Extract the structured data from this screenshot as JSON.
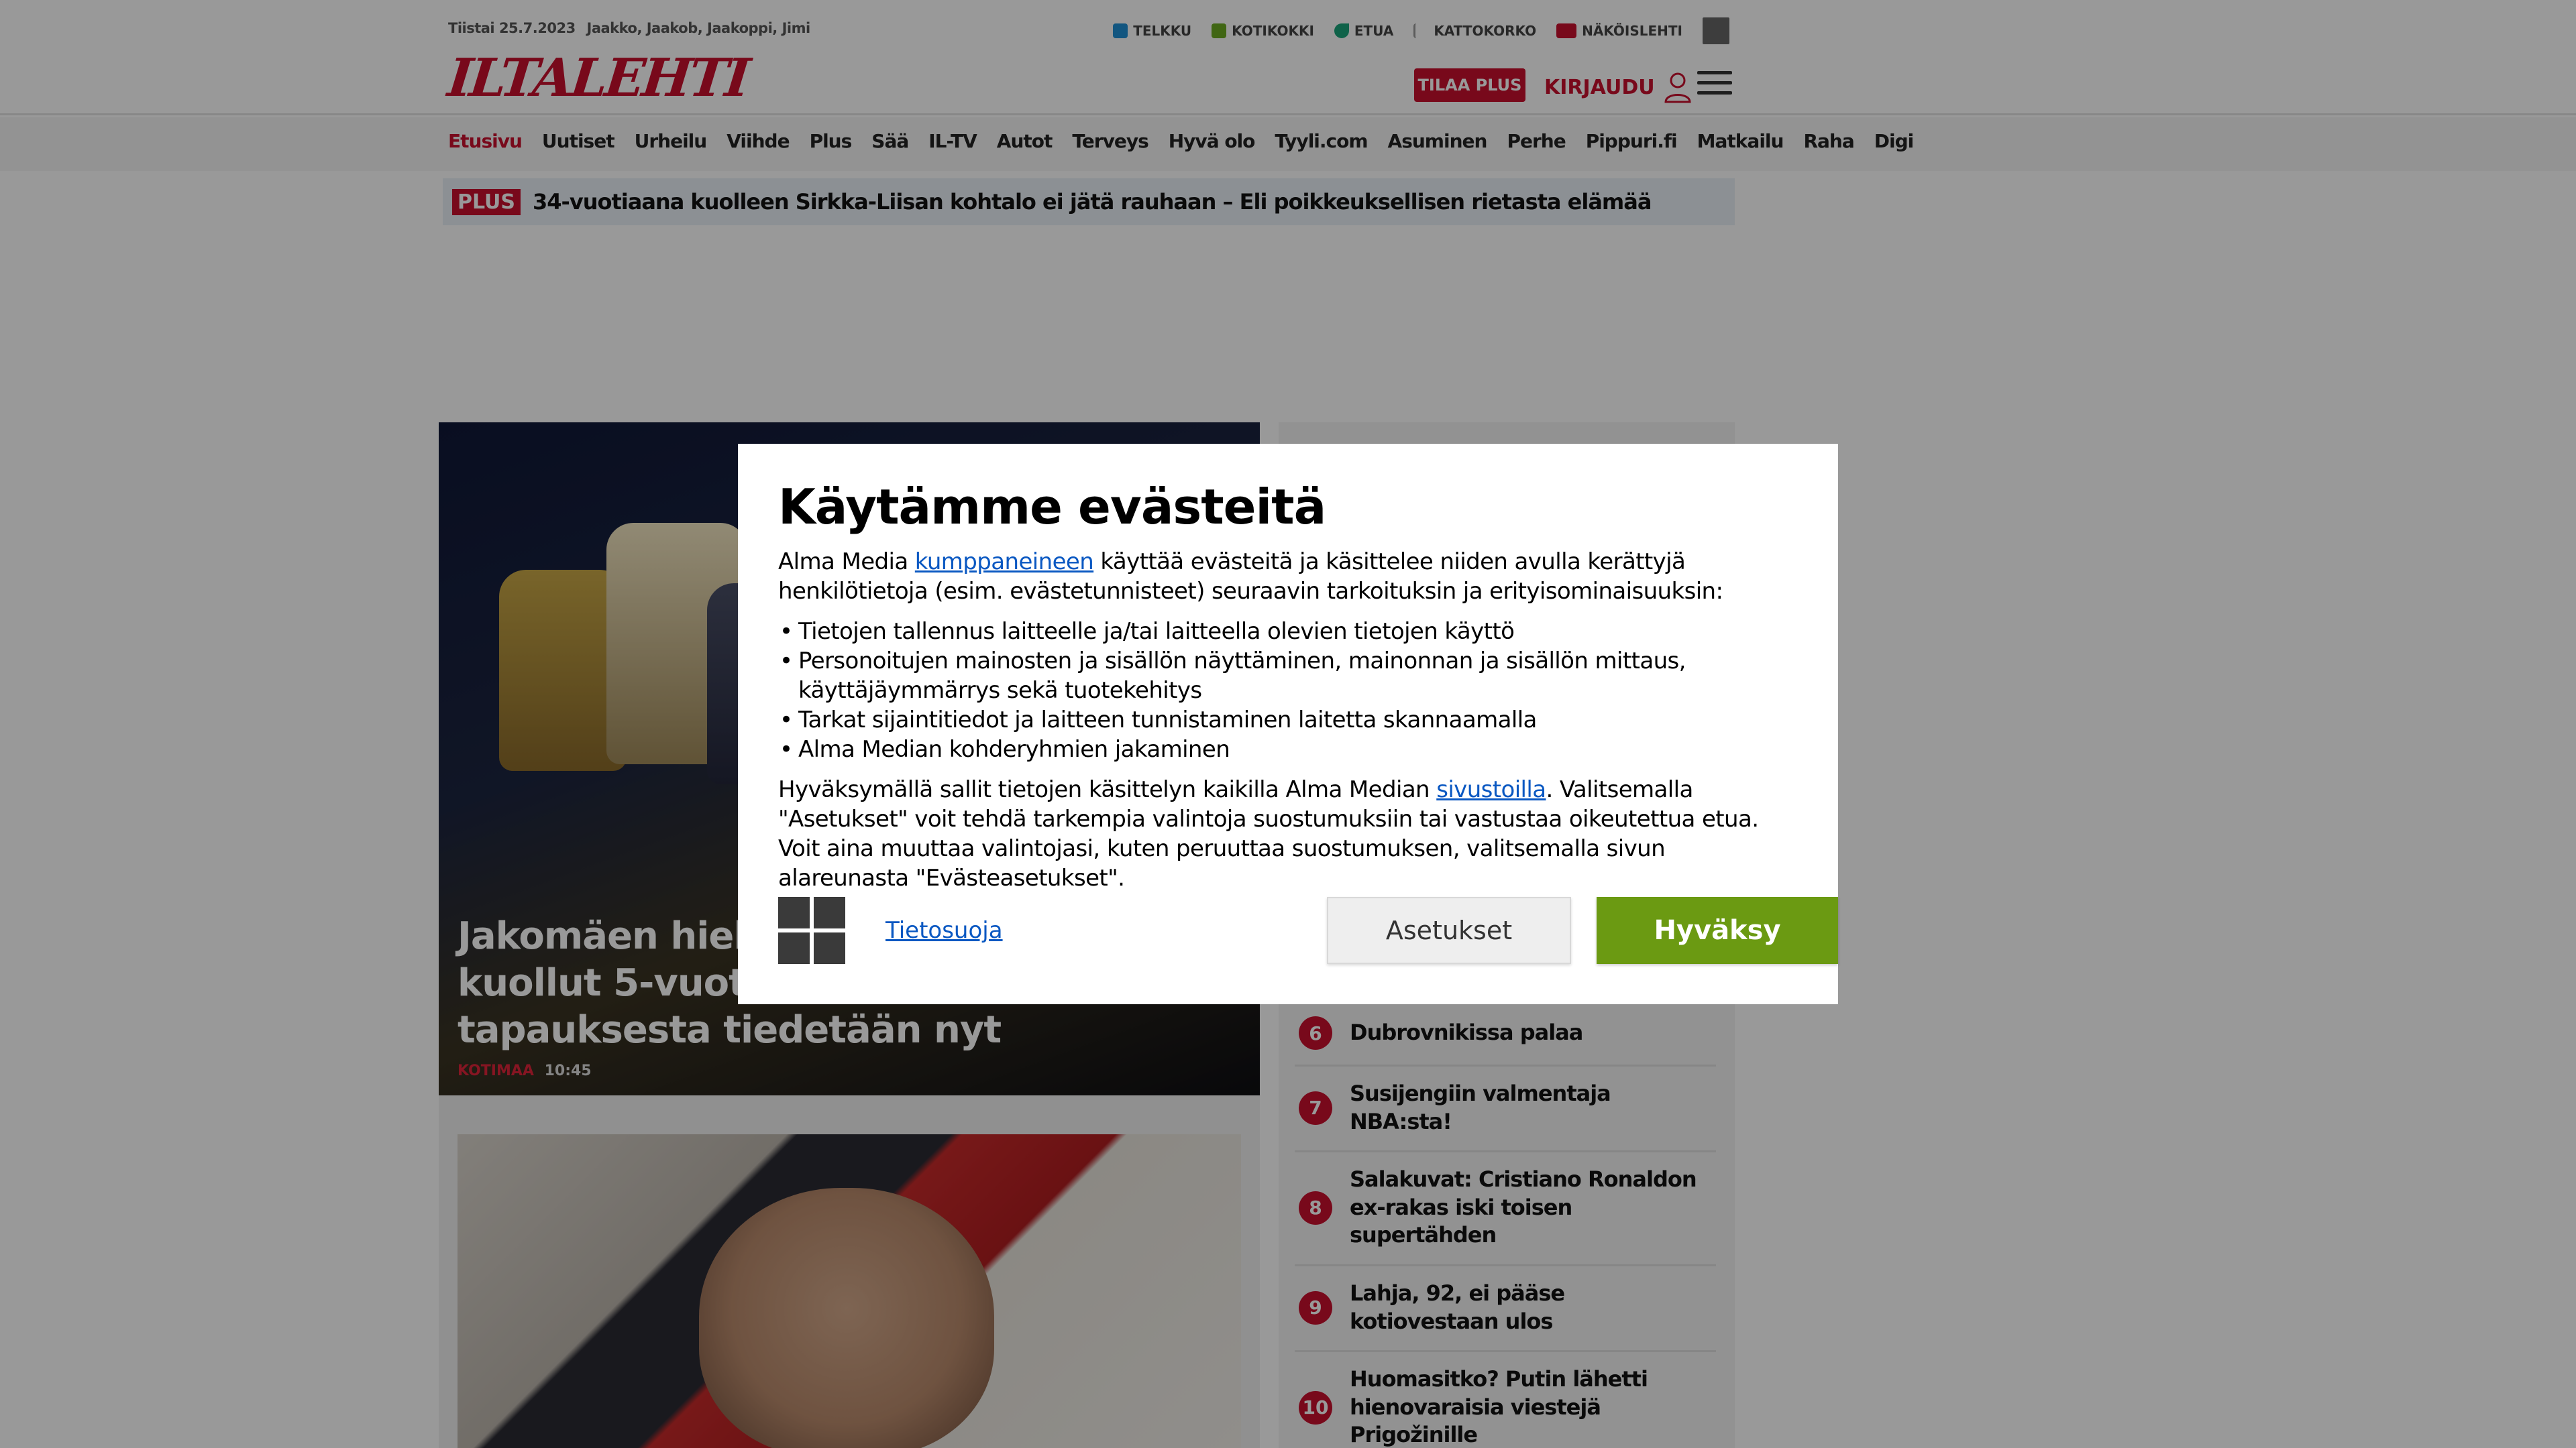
{
  "header": {
    "date": "Tiistai 25.7.2023",
    "namedays": "Jaakko, Jaakob, Jaakoppi, Jimi",
    "services": [
      {
        "label": "TELKKU",
        "icon": "tv-icon",
        "color": "#1f8fd6"
      },
      {
        "label": "KOTIKOKKI",
        "icon": "chef-icon",
        "color": "#6bab21"
      },
      {
        "label": "ETUA",
        "icon": "leaf-icon",
        "color": "#1aa37a"
      },
      {
        "label": "KATTOKORKO",
        "icon": "k-icon",
        "color": "#999999"
      },
      {
        "label": "NÄKÖISLEHTI",
        "icon": "book-icon",
        "color": "#c8102e"
      }
    ],
    "logo": "ILTALEHTI",
    "subscribe_label": "TILAA PLUS",
    "login_label": "KIRJAUDU"
  },
  "nav": {
    "items": [
      "Etusivu",
      "Uutiset",
      "Urheilu",
      "Viihde",
      "Plus",
      "Sää",
      "IL-TV",
      "Autot",
      "Terveys",
      "Hyvä olo",
      "Tyyli.com",
      "Asuminen",
      "Perhe",
      "Pippuri.fi",
      "Matkailu",
      "Raha",
      "Digi"
    ],
    "active": "Etusivu"
  },
  "plus_banner": {
    "badge": "PLUS",
    "text": "34-vuotiaana kuolleen Sirkka-Liisan kohtalo ei jätä rauhaan – Eli poikkeuksellisen rietasta elämää"
  },
  "hero": {
    "title": "Jakomäen hiekkalaatikolta löytyi kuollut 5-vuotias poika – Tämä tapauksesta tiedetään nyt",
    "category": "KOTIMAA",
    "time": "10:45"
  },
  "toplist": [
    {
      "num": "6",
      "text": "Dubrovnikissa palaa"
    },
    {
      "num": "7",
      "text": "Susijengiin valmentaja NBA:sta!"
    },
    {
      "num": "8",
      "text": "Salakuvat: Cristiano Ronaldon ex-rakas iski toisen supertähden"
    },
    {
      "num": "9",
      "text": "Lahja, 92, ei pääse kotiovestaan ulos"
    },
    {
      "num": "10",
      "text": "Huomasitko? Putin lähetti hienovaraisia viestejä Prigožinille"
    }
  ],
  "consent": {
    "title": "Käytämme evästeitä",
    "intro_before": "Alma Media ",
    "intro_link": "kumppaneineen",
    "intro_after": " käyttää evästeitä ja käsittelee niiden avulla kerättyjä henkilötietoja (esim. evästetunnisteet) seuraavin tarkoituksin ja erityisominaisuuksin:",
    "purposes": [
      "Tietojen tallennus laitteelle ja/tai laitteella olevien tietojen käyttö",
      "Personoitujen mainosten ja sisällön näyttäminen, mainonnan ja sisällön mittaus, käyttäjäymmärrys sekä tuotekehitys",
      "Tarkat sijaintitiedot ja laitteen tunnistaminen laitetta skannaamalla",
      "Alma Median kohderyhmien jakaminen"
    ],
    "outro_before": "Hyväksymällä sallit tietojen käsittelyn kaikilla Alma Median ",
    "outro_link": "sivustoilla",
    "outro_after": ". Valitsemalla \"Asetukset\" voit tehdä tarkempia valintoja suostumuksiin tai vastustaa oikeutettua etua. Voit aina muuttaa valintojasi, kuten peruuttaa suostumuksen, valitsemalla sivun alareunasta \"Evästeasetukset\".",
    "privacy_link": "Tietosuoja",
    "settings_button": "Asetukset",
    "accept_button": "Hyväksy",
    "accept_color": "#6b9a12"
  }
}
